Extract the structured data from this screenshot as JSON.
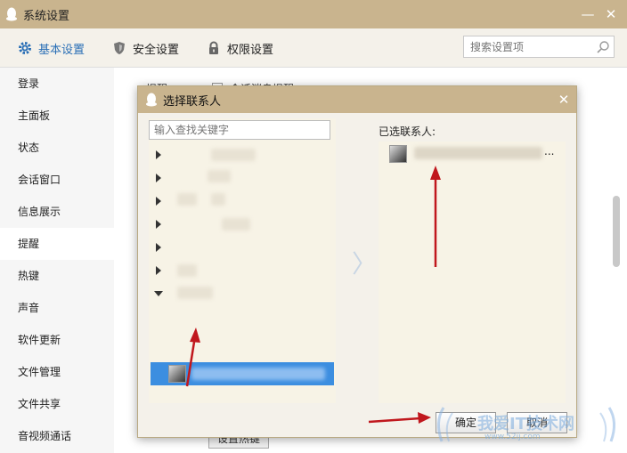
{
  "window": {
    "title": "系统设置",
    "min_glyph": "—",
    "close_glyph": "✕"
  },
  "toolbar": {
    "tabs": [
      {
        "label": "基本设置",
        "icon": "gear-icon",
        "active": true
      },
      {
        "label": "安全设置",
        "icon": "shield-icon",
        "active": false
      },
      {
        "label": "权限设置",
        "icon": "lock-icon",
        "active": false
      }
    ],
    "search_placeholder": "搜索设置项"
  },
  "sidebar": {
    "items": [
      {
        "label": "登录"
      },
      {
        "label": "主面板"
      },
      {
        "label": "状态"
      },
      {
        "label": "会话窗口"
      },
      {
        "label": "信息展示"
      },
      {
        "label": "提醒",
        "active": true
      },
      {
        "label": "热键"
      },
      {
        "label": "声音"
      },
      {
        "label": "软件更新"
      },
      {
        "label": "文件管理"
      },
      {
        "label": "文件共享"
      },
      {
        "label": "音视频通话"
      }
    ]
  },
  "background": {
    "label1": "提醒",
    "label2": "会话消息提醒",
    "button": "设置热键"
  },
  "dialog": {
    "title": "选择联系人",
    "close_glyph": "✕",
    "search_placeholder": "输入查找关键字",
    "selected_label": "已选联系人:",
    "ellipsis": "...",
    "mid_arrow": "〉",
    "ok_label": "确定",
    "cancel_label": "取消"
  },
  "watermark": {
    "text": "我爱IT技术网",
    "sub": "www.52ij.com"
  },
  "colors": {
    "titlebar": "#c9b48e",
    "accent": "#2a6fb6",
    "selection": "#3c8ee0",
    "annotation": "#c0171d"
  }
}
